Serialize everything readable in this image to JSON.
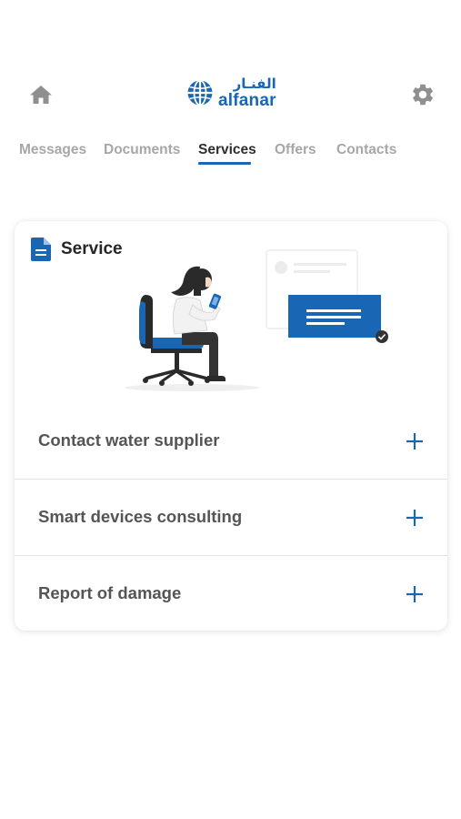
{
  "header": {
    "logo_arabic": "الفنـار",
    "logo_english": "alfanar"
  },
  "tabs": [
    {
      "label": "Messages",
      "active": false
    },
    {
      "label": "Documents",
      "active": false
    },
    {
      "label": "Services",
      "active": true
    },
    {
      "label": "Offers",
      "active": false
    },
    {
      "label": "Contacts",
      "active": false
    }
  ],
  "card": {
    "title": "Service",
    "items": [
      {
        "label": "Contact water supplier"
      },
      {
        "label": "Smart devices consulting"
      },
      {
        "label": "Report of damage"
      }
    ]
  },
  "colors": {
    "accent": "#1866b4",
    "tab_inactive": "#a7a7a7",
    "tab_active": "#2e2e2e",
    "row_text": "#555555"
  },
  "icons": {
    "home": "home-icon",
    "settings": "gear-icon",
    "document": "document-icon",
    "expand": "plus-icon"
  }
}
